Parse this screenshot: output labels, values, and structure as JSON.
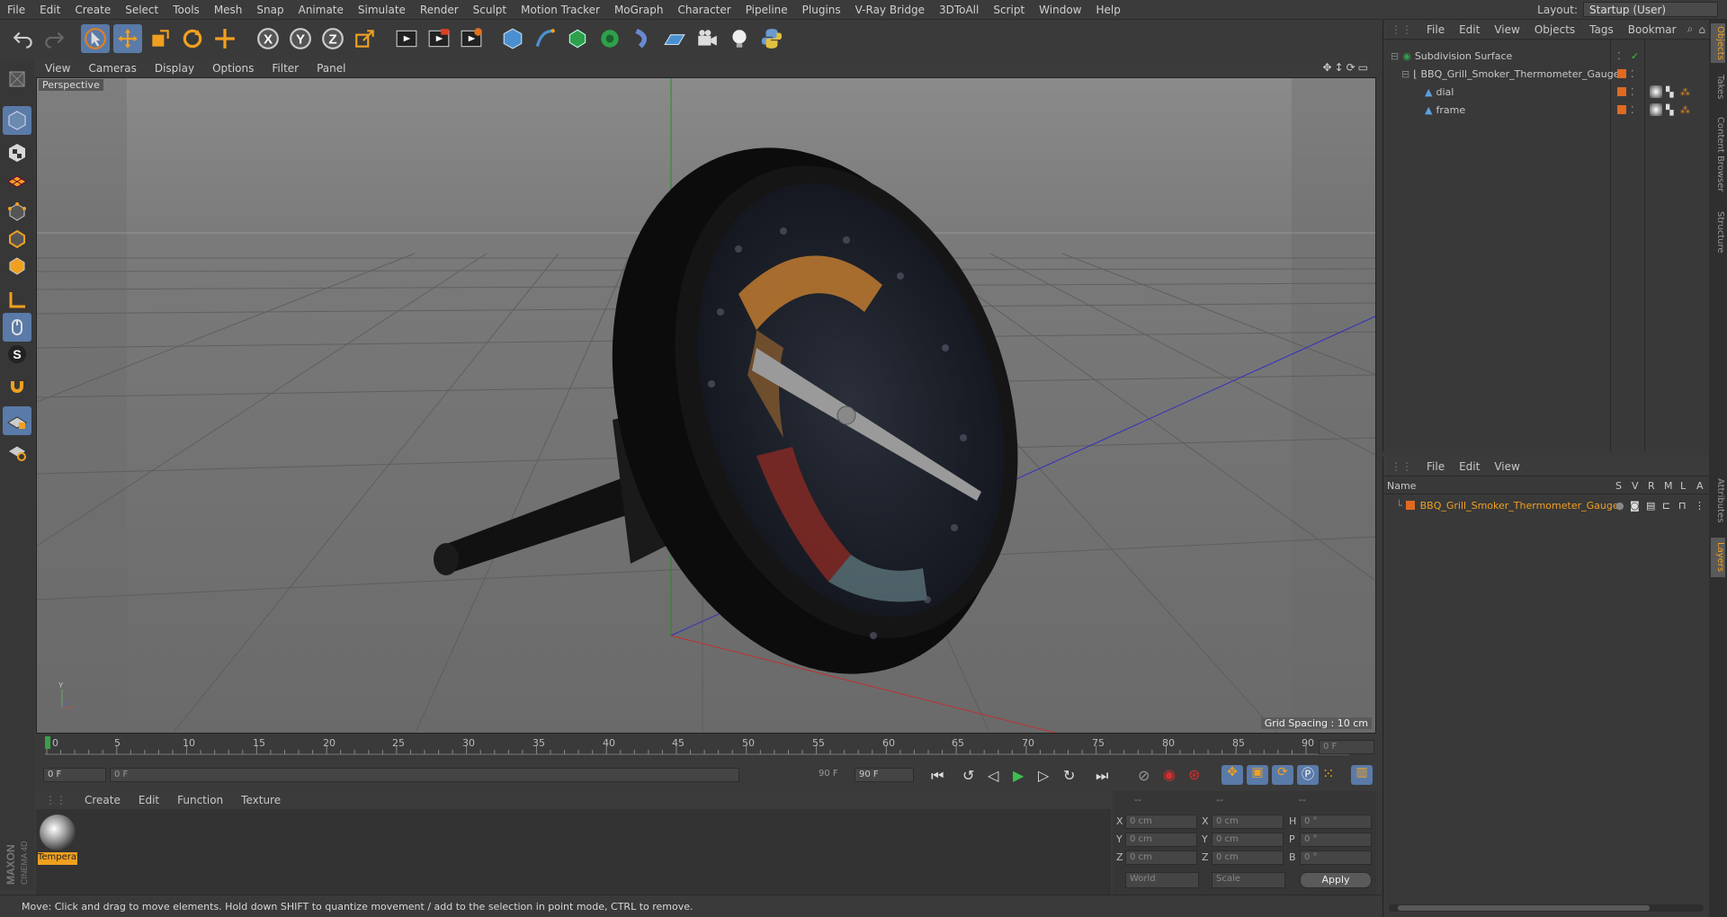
{
  "menu": [
    "File",
    "Edit",
    "Create",
    "Select",
    "Tools",
    "Mesh",
    "Snap",
    "Animate",
    "Simulate",
    "Render",
    "Sculpt",
    "Motion Tracker",
    "MoGraph",
    "Character",
    "Pipeline",
    "Plugins",
    "V-Ray Bridge",
    "3DToAll",
    "Script",
    "Window",
    "Help"
  ],
  "layout": {
    "label": "Layout:",
    "value": "Startup (User)"
  },
  "viewport_menu": [
    "View",
    "Cameras",
    "Display",
    "Options",
    "Filter",
    "Panel"
  ],
  "viewport": {
    "name": "Perspective",
    "grid_spacing": "Grid Spacing : 10 cm"
  },
  "timeline": {
    "ticks": [
      "0",
      "5",
      "10",
      "15",
      "20",
      "25",
      "30",
      "35",
      "40",
      "45",
      "50",
      "55",
      "60",
      "65",
      "70",
      "75",
      "80",
      "85",
      "90"
    ],
    "frame_right": "0 F",
    "start": "0 F",
    "range_start": "0 F",
    "range_end": "90 F",
    "end": "90 F"
  },
  "material_menu": [
    "Create",
    "Edit",
    "Function",
    "Texture"
  ],
  "material": {
    "name": "Temperat"
  },
  "coords": {
    "headers": [
      "--",
      "--",
      "--"
    ],
    "rows": [
      {
        "a": "X",
        "av": "0 cm",
        "b": "X",
        "bv": "0 cm",
        "c": "H",
        "cv": "0 °"
      },
      {
        "a": "Y",
        "av": "0 cm",
        "b": "Y",
        "bv": "0 cm",
        "c": "P",
        "cv": "0 °"
      },
      {
        "a": "Z",
        "av": "0 cm",
        "b": "Z",
        "bv": "0 cm",
        "c": "B",
        "cv": "0 °"
      }
    ],
    "world": "World",
    "scale": "Scale",
    "apply": "Apply"
  },
  "status": "Move: Click and drag to move elements. Hold down SHIFT to quantize movement / add to the selection in point mode, CTRL to remove.",
  "object_manager": {
    "menu": [
      "File",
      "Edit",
      "View",
      "Objects",
      "Tags",
      "Bookmar"
    ],
    "objects": [
      {
        "name": "Subdivision Surface",
        "color": "#2ea04a"
      },
      {
        "name": "BBQ_Grill_Smoker_Thermometer_Gauge",
        "color": "#d0d0d0"
      },
      {
        "name": "dial",
        "color": "#5aa0e0"
      },
      {
        "name": "frame",
        "color": "#5aa0e0"
      }
    ]
  },
  "layer_manager": {
    "menu": [
      "File",
      "Edit",
      "View"
    ],
    "columns": {
      "name": "Name",
      "flags": [
        "S",
        "V",
        "R",
        "M",
        "L",
        "A"
      ]
    },
    "layer": "BBQ_Grill_Smoker_Thermometer_Gauge"
  },
  "right_tabs": [
    "Objects",
    "Takes",
    "Content Browser",
    "Structure",
    "Attributes",
    "Layers"
  ],
  "brand": [
    "MAXON",
    "CINEMA 4D"
  ]
}
